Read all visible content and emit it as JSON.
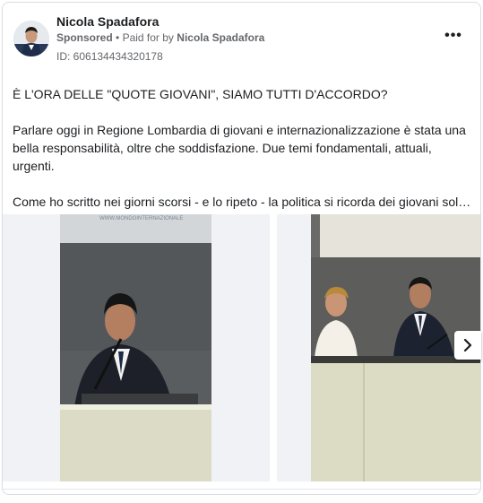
{
  "post": {
    "author": "Nicola Spadafora",
    "sponsored": "Sponsored",
    "separator": "•",
    "paid_for_prefix": "Paid for by",
    "paid_for_name": "Nicola Spadafora",
    "ad_id": "ID: 606134434320178",
    "more_icon": "more-horizontal-icon",
    "more_glyph": "•••"
  },
  "body": {
    "paragraph_1": "È L'ORA DELLE \"QUOTE GIOVANI\", SIAMO TUTTI D'ACCORDO?",
    "paragraph_2": "Parlare oggi in Regione Lombardia di giovani e internazionalizzazione è stata una bella responsabilità, oltre che soddisfazione. Due temi fondamentali, attuali, urgenti.",
    "paragraph_3": "Come ho scritto nei giorni scorsi - e lo ripeto - la politica si ricorda dei giovani sol…"
  },
  "carousel": {
    "slide_1_banner_text": "WWW.MONDOINTERNAZIONALE",
    "next_icon": "chevron-right-icon"
  }
}
